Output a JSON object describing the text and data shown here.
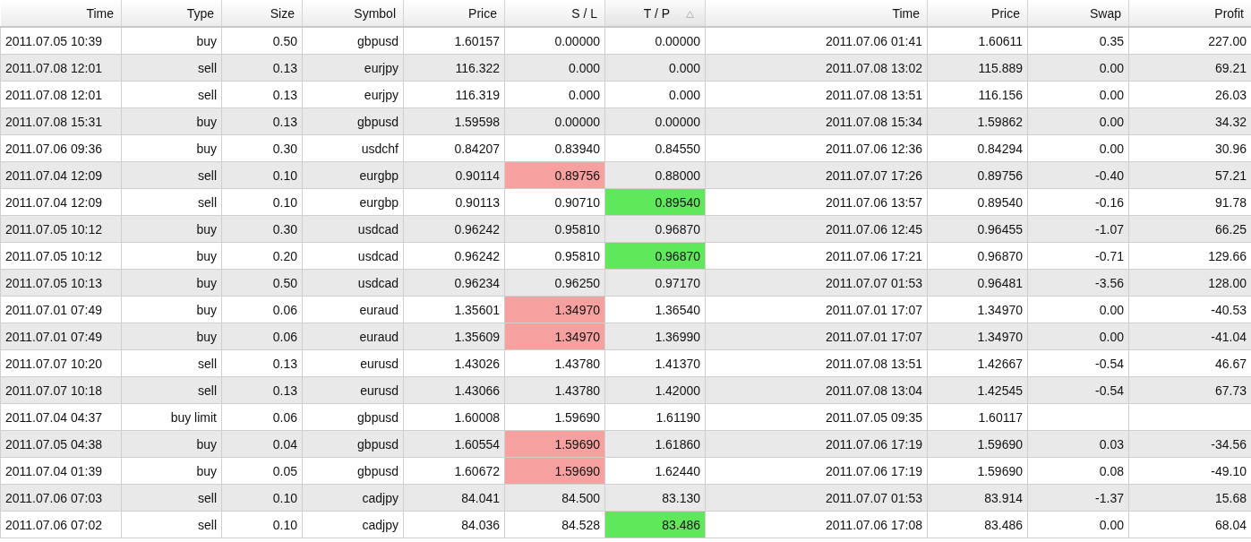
{
  "columns": [
    {
      "label": "Time",
      "sorted": false
    },
    {
      "label": "Type",
      "sorted": false
    },
    {
      "label": "Size",
      "sorted": false
    },
    {
      "label": "Symbol",
      "sorted": false
    },
    {
      "label": "Price",
      "sorted": false
    },
    {
      "label": "S / L",
      "sorted": false
    },
    {
      "label": "T / P",
      "sorted": true
    },
    {
      "label": "Time",
      "sorted": false
    },
    {
      "label": "Price",
      "sorted": false
    },
    {
      "label": "Swap",
      "sorted": false
    },
    {
      "label": "Profit",
      "sorted": false
    }
  ],
  "rows": [
    {
      "open_time": "2011.07.05 10:39",
      "type": "buy",
      "size": "0.50",
      "symbol": "gbpusd",
      "open_price": "1.60157",
      "sl": "0.00000",
      "tp": "0.00000",
      "close_time": "2011.07.06 01:41",
      "close_price": "1.60611",
      "swap": "0.35",
      "profit": "227.00",
      "sl_hit": false,
      "tp_hit": false
    },
    {
      "open_time": "2011.07.08 12:01",
      "type": "sell",
      "size": "0.13",
      "symbol": "eurjpy",
      "open_price": "116.322",
      "sl": "0.000",
      "tp": "0.000",
      "close_time": "2011.07.08 13:02",
      "close_price": "115.889",
      "swap": "0.00",
      "profit": "69.21",
      "sl_hit": false,
      "tp_hit": false
    },
    {
      "open_time": "2011.07.08 12:01",
      "type": "sell",
      "size": "0.13",
      "symbol": "eurjpy",
      "open_price": "116.319",
      "sl": "0.000",
      "tp": "0.000",
      "close_time": "2011.07.08 13:51",
      "close_price": "116.156",
      "swap": "0.00",
      "profit": "26.03",
      "sl_hit": false,
      "tp_hit": false
    },
    {
      "open_time": "2011.07.08 15:31",
      "type": "buy",
      "size": "0.13",
      "symbol": "gbpusd",
      "open_price": "1.59598",
      "sl": "0.00000",
      "tp": "0.00000",
      "close_time": "2011.07.08 15:34",
      "close_price": "1.59862",
      "swap": "0.00",
      "profit": "34.32",
      "sl_hit": false,
      "tp_hit": false
    },
    {
      "open_time": "2011.07.06 09:36",
      "type": "buy",
      "size": "0.30",
      "symbol": "usdchf",
      "open_price": "0.84207",
      "sl": "0.83940",
      "tp": "0.84550",
      "close_time": "2011.07.06 12:36",
      "close_price": "0.84294",
      "swap": "0.00",
      "profit": "30.96",
      "sl_hit": false,
      "tp_hit": false
    },
    {
      "open_time": "2011.07.04 12:09",
      "type": "sell",
      "size": "0.10",
      "symbol": "eurgbp",
      "open_price": "0.90114",
      "sl": "0.89756",
      "tp": "0.88000",
      "close_time": "2011.07.07 17:26",
      "close_price": "0.89756",
      "swap": "-0.40",
      "profit": "57.21",
      "sl_hit": true,
      "tp_hit": false
    },
    {
      "open_time": "2011.07.04 12:09",
      "type": "sell",
      "size": "0.10",
      "symbol": "eurgbp",
      "open_price": "0.90113",
      "sl": "0.90710",
      "tp": "0.89540",
      "close_time": "2011.07.06 13:57",
      "close_price": "0.89540",
      "swap": "-0.16",
      "profit": "91.78",
      "sl_hit": false,
      "tp_hit": true
    },
    {
      "open_time": "2011.07.05 10:12",
      "type": "buy",
      "size": "0.30",
      "symbol": "usdcad",
      "open_price": "0.96242",
      "sl": "0.95810",
      "tp": "0.96870",
      "close_time": "2011.07.06 12:45",
      "close_price": "0.96455",
      "swap": "-1.07",
      "profit": "66.25",
      "sl_hit": false,
      "tp_hit": false
    },
    {
      "open_time": "2011.07.05 10:12",
      "type": "buy",
      "size": "0.20",
      "symbol": "usdcad",
      "open_price": "0.96242",
      "sl": "0.95810",
      "tp": "0.96870",
      "close_time": "2011.07.06 17:21",
      "close_price": "0.96870",
      "swap": "-0.71",
      "profit": "129.66",
      "sl_hit": false,
      "tp_hit": true
    },
    {
      "open_time": "2011.07.05 10:13",
      "type": "buy",
      "size": "0.50",
      "symbol": "usdcad",
      "open_price": "0.96234",
      "sl": "0.96250",
      "tp": "0.97170",
      "close_time": "2011.07.07 01:53",
      "close_price": "0.96481",
      "swap": "-3.56",
      "profit": "128.00",
      "sl_hit": false,
      "tp_hit": false
    },
    {
      "open_time": "2011.07.01 07:49",
      "type": "buy",
      "size": "0.06",
      "symbol": "euraud",
      "open_price": "1.35601",
      "sl": "1.34970",
      "tp": "1.36540",
      "close_time": "2011.07.01 17:07",
      "close_price": "1.34970",
      "swap": "0.00",
      "profit": "-40.53",
      "sl_hit": true,
      "tp_hit": false
    },
    {
      "open_time": "2011.07.01 07:49",
      "type": "buy",
      "size": "0.06",
      "symbol": "euraud",
      "open_price": "1.35609",
      "sl": "1.34970",
      "tp": "1.36990",
      "close_time": "2011.07.01 17:07",
      "close_price": "1.34970",
      "swap": "0.00",
      "profit": "-41.04",
      "sl_hit": true,
      "tp_hit": false
    },
    {
      "open_time": "2011.07.07 10:20",
      "type": "sell",
      "size": "0.13",
      "symbol": "eurusd",
      "open_price": "1.43026",
      "sl": "1.43780",
      "tp": "1.41370",
      "close_time": "2011.07.08 13:51",
      "close_price": "1.42667",
      "swap": "-0.54",
      "profit": "46.67",
      "sl_hit": false,
      "tp_hit": false
    },
    {
      "open_time": "2011.07.07 10:18",
      "type": "sell",
      "size": "0.13",
      "symbol": "eurusd",
      "open_price": "1.43066",
      "sl": "1.43780",
      "tp": "1.42000",
      "close_time": "2011.07.08 13:04",
      "close_price": "1.42545",
      "swap": "-0.54",
      "profit": "67.73",
      "sl_hit": false,
      "tp_hit": false
    },
    {
      "open_time": "2011.07.04 04:37",
      "type": "buy limit",
      "size": "0.06",
      "symbol": "gbpusd",
      "open_price": "1.60008",
      "sl": "1.59690",
      "tp": "1.61190",
      "close_time": "2011.07.05 09:35",
      "close_price": "1.60117",
      "sl_hit": false,
      "tp_hit": false
    },
    {
      "open_time": "2011.07.05 04:38",
      "type": "buy",
      "size": "0.04",
      "symbol": "gbpusd",
      "open_price": "1.60554",
      "sl": "1.59690",
      "tp": "1.61860",
      "close_time": "2011.07.06 17:19",
      "close_price": "1.59690",
      "swap": "0.03",
      "profit": "-34.56",
      "sl_hit": true,
      "tp_hit": false
    },
    {
      "open_time": "2011.07.04 01:39",
      "type": "buy",
      "size": "0.05",
      "symbol": "gbpusd",
      "open_price": "1.60672",
      "sl": "1.59690",
      "tp": "1.62440",
      "close_time": "2011.07.06 17:19",
      "close_price": "1.59690",
      "swap": "0.08",
      "profit": "-49.10",
      "sl_hit": true,
      "tp_hit": false
    },
    {
      "open_time": "2011.07.06 07:03",
      "type": "sell",
      "size": "0.10",
      "symbol": "cadjpy",
      "open_price": "84.041",
      "sl": "84.500",
      "tp": "83.130",
      "close_time": "2011.07.07 01:53",
      "close_price": "83.914",
      "swap": "-1.37",
      "profit": "15.68",
      "sl_hit": false,
      "tp_hit": false
    },
    {
      "open_time": "2011.07.06 07:02",
      "type": "sell",
      "size": "0.10",
      "symbol": "cadjpy",
      "open_price": "84.036",
      "sl": "84.528",
      "tp": "83.486",
      "close_time": "2011.07.06 17:08",
      "close_price": "83.486",
      "swap": "0.00",
      "profit": "68.04",
      "sl_hit": false,
      "tp_hit": true
    }
  ]
}
